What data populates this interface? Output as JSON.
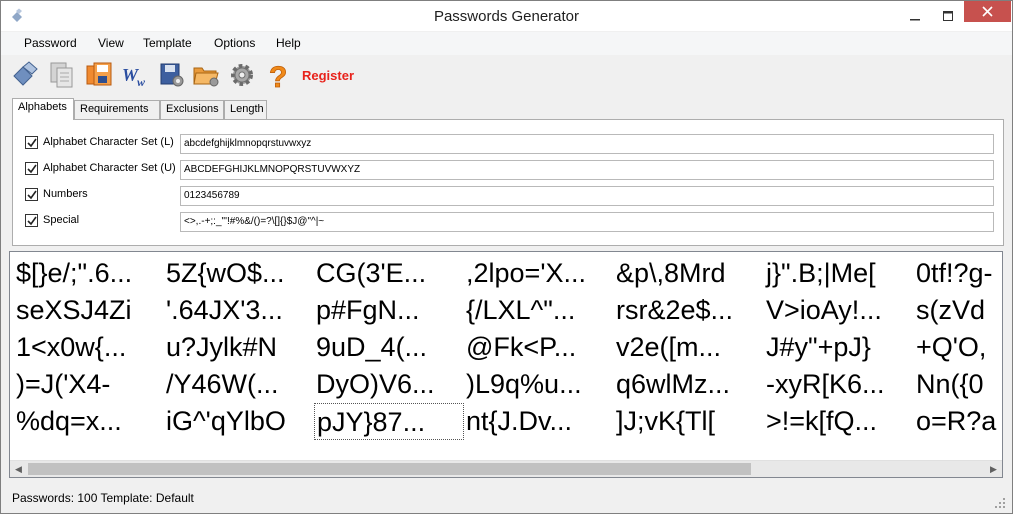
{
  "window": {
    "title": "Passwords Generator"
  },
  "menu": {
    "items": [
      "Password",
      "View",
      "Template",
      "Options",
      "Help"
    ]
  },
  "toolbar": {
    "icons": [
      "generate-icon",
      "copy-icon",
      "save-icon",
      "word-icon",
      "settings-save-icon",
      "open-folder-icon",
      "gear-icon",
      "help-icon"
    ],
    "register_label": "Register"
  },
  "tabs": [
    {
      "label": "Alphabets",
      "active": true
    },
    {
      "label": "Requirements",
      "active": false
    },
    {
      "label": "Exclusions",
      "active": false
    },
    {
      "label": "Length",
      "active": false
    }
  ],
  "alphabets": [
    {
      "label": "Alphabet Character Set (L)",
      "checked": true,
      "value": "abcdefghijklmnopqrstuvwxyz"
    },
    {
      "label": "Alphabet Character Set (U)",
      "checked": true,
      "value": "ABCDEFGHIJKLMNOPQRSTUVWXYZ"
    },
    {
      "label": "Numbers",
      "checked": true,
      "value": "0123456789"
    },
    {
      "label": "Special",
      "checked": true,
      "value": "<>,.-+;:_\"'!#%&/()=?\\[]{}$J@\"^|~"
    }
  ],
  "passwords": [
    [
      "$[}e/;\".6...",
      "5Z{wO$...",
      "CG(3'E...",
      ",2lpo='X...",
      "&p\\,8Mrd",
      "j}\".B;|Me[",
      "0tf!?g-"
    ],
    [
      "seXSJ4Zi",
      "'.64JX'3...",
      "p#FgN...",
      "{/LXL^\"...",
      "rsr&2e$...",
      "V>ioAy!...",
      "s(zVd"
    ],
    [
      "1<x0w{...",
      "u?Jylk#N",
      "9uD_4(...",
      "@Fk<P...",
      "v2e([m...",
      "J#y\"+pJ}",
      "+Q'O,"
    ],
    [
      ")=J('X4-",
      "/Y46W(...",
      "DyO)V6...",
      ")L9q%u...",
      "q6wlMz...",
      "-xyR[K6...",
      "Nn({0"
    ],
    [
      "%dq=x...",
      "iG^'qYlbO",
      "pJY}87...",
      "nt{J.Dv...",
      "]J;vK{Tl[",
      ">!=k[fQ...",
      "o=R?a"
    ]
  ],
  "selected_cell": [
    4,
    2
  ],
  "status": {
    "text": "Passwords: 100   Template: Default"
  }
}
